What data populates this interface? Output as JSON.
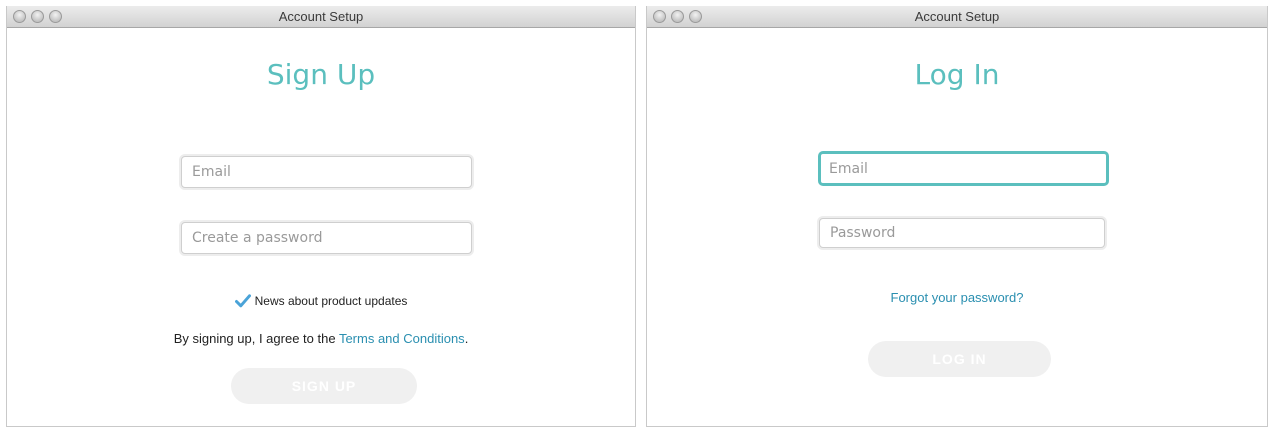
{
  "colors": {
    "accent": "#5bbfbe",
    "link": "#2a8fb0",
    "button_disabled_bg": "#f0f0f0",
    "check": "#4aa3d8"
  },
  "signup_window": {
    "title": "Account Setup",
    "heading": "Sign Up",
    "email_placeholder": "Email",
    "password_placeholder": "Create a password",
    "news_checkbox_label": "News about product updates",
    "news_checked": true,
    "agree_prefix": "By signing up, I agree to the ",
    "terms_link": "Terms and Conditions",
    "agree_suffix": ".",
    "submit_label": "SIGN UP"
  },
  "login_window": {
    "title": "Account Setup",
    "heading": "Log In",
    "email_placeholder": "Email",
    "password_placeholder": "Password",
    "forgot_link": "Forgot your password?",
    "submit_label": "LOG IN"
  }
}
